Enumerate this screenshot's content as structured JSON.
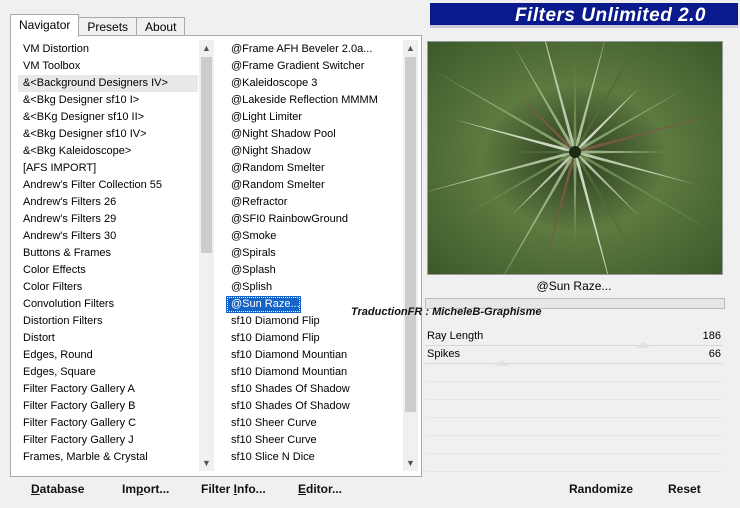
{
  "tabs": [
    {
      "label": "Navigator"
    },
    {
      "label": "Presets"
    },
    {
      "label": "About"
    }
  ],
  "banner_title": "Filters Unlimited 2.0",
  "categories": [
    "VM Distortion",
    "VM Toolbox",
    "&<Background Designers IV>",
    "&<Bkg Designer sf10 I>",
    "&<BKg Designer sf10 II>",
    "&<Bkg Designer sf10 IV>",
    "&<Bkg Kaleidoscope>",
    "[AFS IMPORT]",
    "Andrew's Filter Collection 55",
    "Andrew's Filters 26",
    "Andrew's Filters 29",
    "Andrew's Filters 30",
    "Buttons & Frames",
    "Color Effects",
    "Color Filters",
    "Convolution Filters",
    "Distortion Filters",
    "Distort",
    "Edges, Round",
    "Edges, Square",
    "Filter Factory Gallery A",
    "Filter Factory Gallery B",
    "Filter Factory Gallery C",
    "Filter Factory Gallery J",
    "Frames, Marble & Crystal"
  ],
  "filters": [
    "@Frame AFH Beveler 2.0a...",
    "@Frame Gradient Switcher",
    "@Kaleidoscope 3",
    "@Lakeside Reflection MMMM",
    "@Light Limiter",
    "@Night Shadow Pool",
    "@Night Shadow",
    "@Random Smelter",
    "@Random Smelter",
    "@Refractor",
    "@SFI0 RainbowGround",
    "@Smoke",
    "@Spirals",
    "@Splash",
    "@Splish",
    "@Sun Raze...",
    "sf10 Diamond Flip",
    "sf10 Diamond Flip",
    "sf10 Diamond Mountian",
    "sf10 Diamond Mountian",
    "sf10 Shades Of Shadow",
    "sf10 Shades Of Shadow",
    "sf10 Sheer Curve",
    "sf10 Sheer Curve",
    "sf10 Slice N Dice"
  ],
  "selected_category_index": 2,
  "selected_filter_index": 15,
  "current_filter_name": "@Sun Raze...",
  "credit_text": "TraductionFR : MicheleB-Graphisme",
  "params": [
    {
      "label": "Ray Length",
      "value": "186",
      "level": 0.73
    },
    {
      "label": "Spikes",
      "value": "66",
      "level": 0.26
    }
  ],
  "bottom_buttons": {
    "database": {
      "mnemonic": "D",
      "rest": "atabase"
    },
    "import": {
      "pre": "Im",
      "mnemonic": "p",
      "rest": "ort..."
    },
    "filter_info": {
      "pre": "Filter ",
      "mnemonic": "I",
      "rest": "nfo..."
    },
    "editor": {
      "mnemonic": "E",
      "rest": "ditor..."
    }
  },
  "right_buttons": {
    "randomize": "Randomize",
    "reset": "Reset"
  },
  "colors": {
    "banner_bg": "#0a1a8c",
    "selection_blue": "#1565c8"
  }
}
